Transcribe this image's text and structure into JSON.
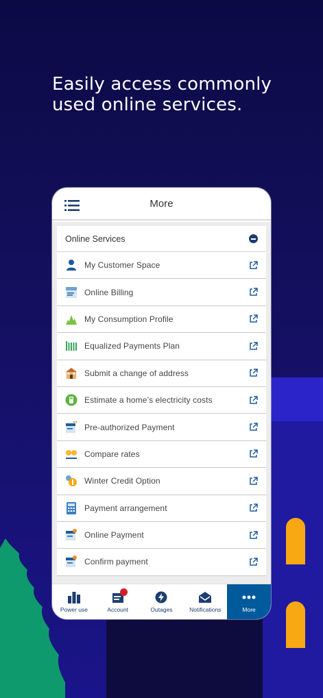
{
  "headline": "Easily access commonly used online services.",
  "app": {
    "title": "More",
    "section_title": "Online Services",
    "items": [
      {
        "label": "My Customer Space",
        "icon": "person-icon"
      },
      {
        "label": "Online Billing",
        "icon": "bill-icon"
      },
      {
        "label": "My Consumption Profile",
        "icon": "consumption-chart-icon"
      },
      {
        "label": "Equalized Payments Plan",
        "icon": "equalized-plan-icon"
      },
      {
        "label": "Submit a change of address",
        "icon": "house-icon"
      },
      {
        "label": "Estimate a home’s electricity costs",
        "icon": "estimate-icon"
      },
      {
        "label": "Pre-authorized Payment",
        "icon": "preauthorized-payment-icon"
      },
      {
        "label": "Compare rates",
        "icon": "compare-rates-icon"
      },
      {
        "label": "Winter Credit Option",
        "icon": "winter-credit-icon"
      },
      {
        "label": "Payment arrangement",
        "icon": "calculator-icon"
      },
      {
        "label": "Online Payment",
        "icon": "online-payment-icon"
      },
      {
        "label": "Confirm payment",
        "icon": "confirm-payment-icon"
      }
    ],
    "tabs": [
      {
        "label": "Power use",
        "icon": "bar-chart-icon"
      },
      {
        "label": "Account",
        "icon": "account-icon"
      },
      {
        "label": "Outages",
        "icon": "outage-bolt-icon"
      },
      {
        "label": "Notifications",
        "icon": "envelope-icon"
      },
      {
        "label": "More",
        "icon": "more-dots-icon"
      }
    ],
    "active_tab": "More"
  },
  "colors": {
    "background": "#120f55",
    "primary_blue": "#005a9c",
    "navy": "#1d3e6e",
    "accent_orange": "#f7a813",
    "badge_red": "#d11e2b",
    "tree_green": "#0f9a6e"
  }
}
